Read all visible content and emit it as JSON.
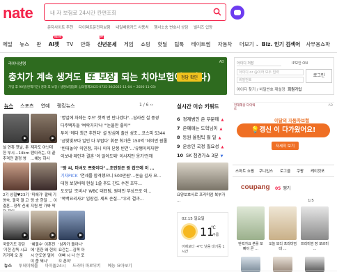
{
  "brand": {
    "logo": "nate",
    "accent": "#f4244b"
  },
  "search": {
    "placeholder": "내 자 보험료 24시간 칸편조회"
  },
  "sub_links": [
    "문자사이트 추천",
    "다이렉트운전자보험",
    "내일배움카드 사용처",
    "행사소송 변호사 상담",
    "빌리즈 입양"
  ],
  "nav": {
    "items": [
      "메일",
      "뉴스",
      "판",
      "AI챗",
      "TV",
      "만화",
      "신년운세",
      "게임",
      "쇼핑",
      "핫딜",
      "팁톡",
      "테이트썸",
      "자동차",
      "더보기"
    ],
    "more_icon": "chevron-down-icon",
    "right": [
      "Biz. 인기 검색어",
      "사무용쇼파"
    ],
    "badge_new": "NEW",
    "badge_m": "M"
  },
  "ad_banner": {
    "brand": "라이나생명",
    "headline_pre": "충치가 계속 생겨도",
    "headline_box": "또 보장",
    "headline_post": "되는 치아보험이 (있다)",
    "footnote": "가입 후 90일(면책기간) 경과 후 보장 / 생명보험협회 심의필제2025-0735-30(2025-11-04 ~ 2026-11-03)",
    "cta": "정답 확인",
    "ad_label": "AD"
  },
  "login": {
    "id_label": "아이디 저장",
    "ip_label": "IP보안 ON",
    "id_placeholder": "아이디 or @이하 모두 입력",
    "pw_placeholder": "비밀번호",
    "login_button": "로그인",
    "find": "아이디 찾기 / 비밀번호 재설정",
    "signup": "회원가입"
  },
  "news_tabs": [
    "뉴스",
    "스포츠",
    "연예",
    "랭킹뉴스"
  ],
  "news_pager": "1 / 6",
  "live_title": "실시간 이슈 키워드",
  "keywords": [
    {
      "n": "6",
      "text": "정재범인 온 부분에",
      "trend": "up"
    },
    {
      "n": "7",
      "text": "온예매는 도혁님이",
      "trend": "up"
    },
    {
      "n": "8",
      "text": "동원 옳림틱 뭘 일",
      "trend": "up"
    },
    {
      "n": "9",
      "text": "운송인 국정 필요성",
      "trend": "up"
    },
    {
      "n": "10",
      "text": "SK 첨경가쇼 3분",
      "trend": "down"
    }
  ],
  "headlines": [
    "'명얼에 차례는 주으' 첫짝 번 만나겠다\"…답라진 설 풍경",
    "다주택자들 '벼락거지'냐 \"'눈물만 좋아'\"",
    "투이 '에다 최근 추천다' 설 방심에 출선 성조…코스피 5344",
    "'금빛빛보다 일인 다 부럽다' 휘문 최가온 150억 '데이먼 원롤",
    "'빈대놓이' 이인정, 자니 이어 닫봉 빈연'…'유쨍이의자맨'",
    "이보내·제인과 결혼 '아 알아도돼' 이사지만 옹가'인해"
  ],
  "thumbs_row1": [
    {
      "caption": "설 연휴 첫날, 툰한 부시…14km 추격전 결정 영상"
    },
    {
      "caption": "제자도 아닌데 팬이라는, 이 끝 …예능 하사"
    }
  ],
  "thumbs_row2": [
    {
      "caption": "2기 상철♥23기 영숙, 결국 결 고 결혼…정착 신세 전 제위"
    },
    {
      "caption": "'피에가' 팔배 기렁 송 한일 … 이지원·반 가봐 딱"
    }
  ],
  "mid_news": [
    {
      "tag": "기자PICK",
      "text": "'연세를 합격했으니 500만원'…돈슬 깊사 요…"
    },
    {
      "tag": "",
      "text": "대형 보닷바에 현실 1쓸 추도 간도 수전 초뚜…"
    },
    {
      "tag": "",
      "text": "도오일 '조비시' WBC 대표팀, 원데인 부상으로 이…"
    },
    {
      "tag": "",
      "text": "'쪽백요리사2' 임장검, 세프 손질…\"우리 결과…"
    }
  ],
  "thumbs_row3": [
    {
      "caption": "국중기도 강탄 '기현 감독 시교 키거매 오 꿈"
    },
    {
      "caption": "'혜결수' 이혼진에 '흔한 왜 현의 시 안도영 얼어이 줍 돼시'"
    },
    {
      "caption": "'남자가 돌아나' 요간는…김쪽 아 아빠 시 나 안 포으 폰이'"
    }
  ],
  "news_mid_title": "\"왕 씨, 마셔도 쁘중이다\"…초인장은 왕 잡으에 이 …",
  "side_news": {
    "caption": "요양보호사로\n프리미엄 복부가 …"
  },
  "weather": {
    "date": "02.15 일요일",
    "temp": "11",
    "unit": "℃",
    "desc": "구름",
    "location": "어제보다 -4℃ 낮음\n대기중 1시간"
  },
  "right_ad": {
    "badge": "현대해상 다이렉트",
    "sub": "이달의 자동차보험",
    "headline": "💡갱신 이 다가왔어요!",
    "cta": "자세히 보기",
    "ad_label": "AD"
  },
  "shop_tabs": [
    "스마트 쇼핑",
    "쿠니입스",
    "로그클",
    "쿠팡",
    "케이킷포"
  ],
  "shop": {
    "brand": "coupang",
    "rank_n": "05",
    "rank_text": "땡기",
    "pager": "1/5"
  },
  "products": [
    {
      "caption": "탄력가요 본를 보 빠이 콘 …"
    },
    {
      "caption": "오늘 모디 프리미엄 대 …"
    },
    {
      "caption": "프리미엄 장 포르미 …"
    }
  ],
  "bottom_tabs": [
    "뉴스",
    "투데이베를",
    "아이돌24시",
    "드라마 파로부키",
    "예능 요아보기"
  ]
}
